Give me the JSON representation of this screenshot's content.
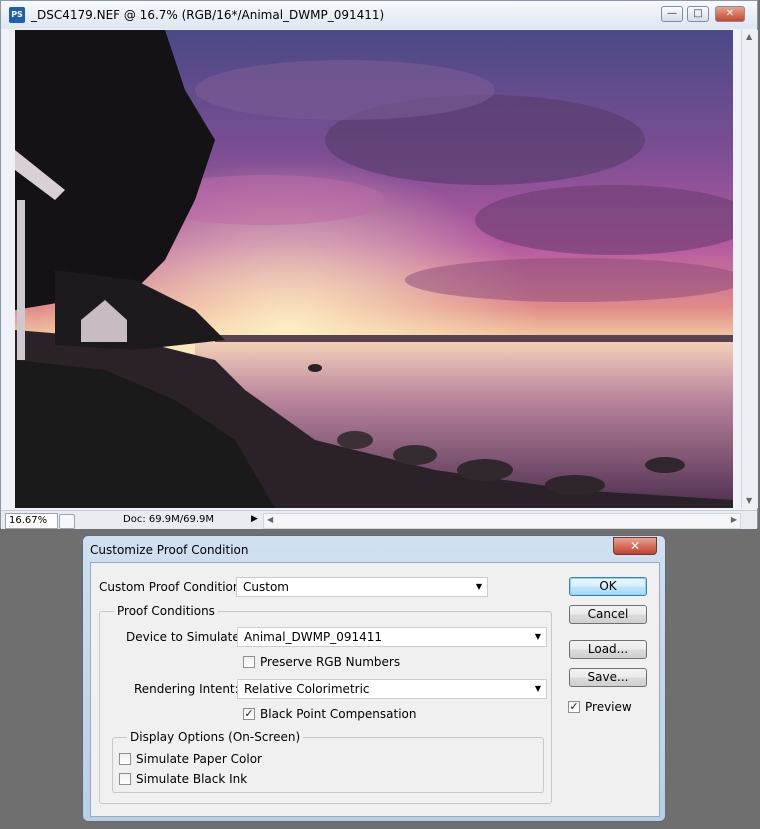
{
  "document_window": {
    "app_icon": "PS",
    "title": "_DSC4179.NEF @ 16.7% (RGB/16*/Animal_DWMP_091411)",
    "buttons": {
      "minimize": "minimize-icon",
      "restore": "restore-icon",
      "close": "close-icon"
    },
    "status": {
      "zoom": "16.67%",
      "doc_info": "Doc: 69.9M/69.9M"
    }
  },
  "dialog": {
    "title": "Customize Proof Condition",
    "custom_proof_condition_label": "Custom Proof Condition:",
    "custom_proof_condition_value": "Custom",
    "proof_conditions_group": "Proof Conditions",
    "device_to_simulate_label": "Device to Simulate:",
    "device_to_simulate_value": "Animal_DWMP_091411",
    "preserve_rgb_label": "Preserve RGB Numbers",
    "preserve_rgb_checked": false,
    "rendering_intent_label": "Rendering Intent:",
    "rendering_intent_value": "Relative Colorimetric",
    "black_point_label": "Black Point Compensation",
    "black_point_checked": true,
    "display_options_group": "Display Options (On-Screen)",
    "simulate_paper_label": "Simulate Paper Color",
    "simulate_paper_checked": false,
    "simulate_ink_label": "Simulate Black Ink",
    "simulate_ink_checked": false,
    "buttons": {
      "ok": "OK",
      "cancel": "Cancel",
      "load": "Load...",
      "save": "Save..."
    },
    "preview_label": "Preview",
    "preview_checked": true
  }
}
